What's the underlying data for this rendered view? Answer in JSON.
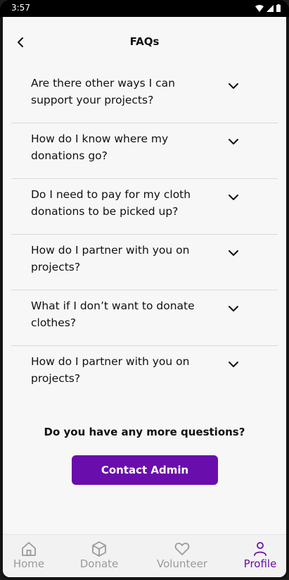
{
  "status": {
    "time": "3:57"
  },
  "header": {
    "title": "FAQs"
  },
  "faqs": [
    {
      "question": "Are there other ways I can support your projects?"
    },
    {
      "question": "How do I know where my donations go?"
    },
    {
      "question": "Do I need to pay for my cloth donations to be picked up?"
    },
    {
      "question": "How do I partner with you on projects?"
    },
    {
      "question": "What if I don’t want to donate clothes?"
    },
    {
      "question": "How do I partner with you on projects?"
    }
  ],
  "support": {
    "prompt": "Do you have any more questions?",
    "button_label": "Contact Admin"
  },
  "nav": {
    "items": [
      {
        "label": "Home",
        "icon": "home-icon"
      },
      {
        "label": "Donate",
        "icon": "box-icon"
      },
      {
        "label": "Volunteer",
        "icon": "heart-icon"
      },
      {
        "label": "Profile",
        "icon": "user-icon",
        "active": true
      }
    ]
  },
  "colors": {
    "accent": "#6a0dad",
    "inactive": "#9a9a9a",
    "background": "#f7f7f7"
  }
}
